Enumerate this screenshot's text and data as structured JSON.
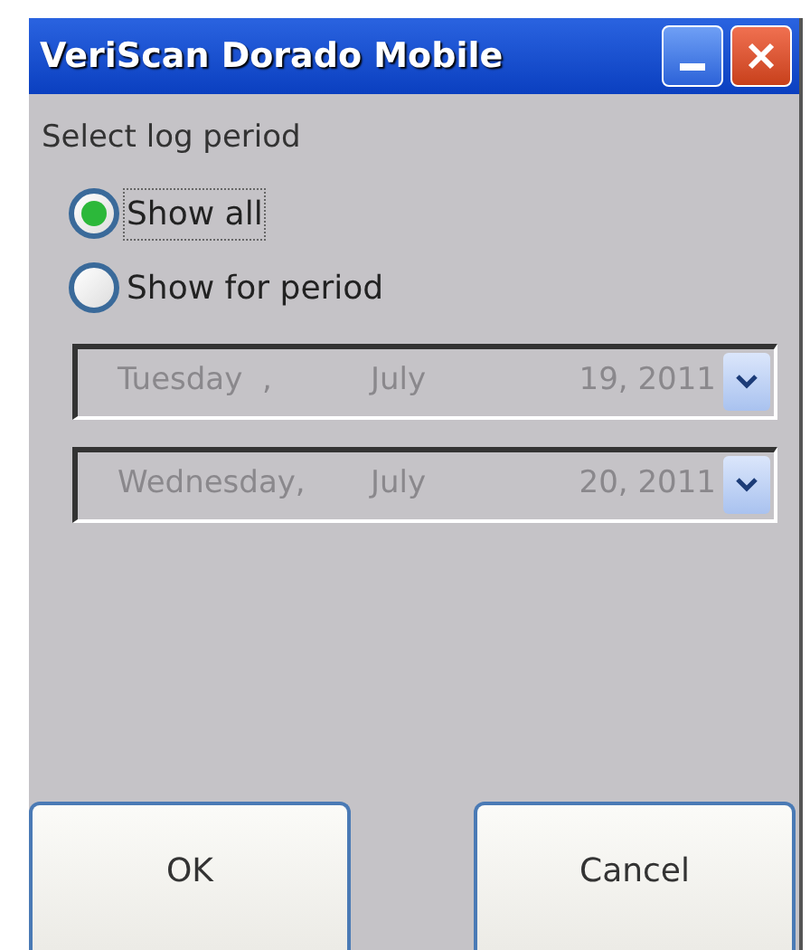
{
  "window": {
    "title": "VeriScan Dorado Mobile"
  },
  "group_label": "Select log period",
  "options": [
    {
      "label": "Show all",
      "selected": true,
      "focused": true
    },
    {
      "label": "Show for period",
      "selected": false,
      "focused": false
    }
  ],
  "date_pickers": [
    {
      "weekday": "Tuesday  ,",
      "month": "July",
      "date": "19, 2011",
      "disabled": true
    },
    {
      "weekday": "Wednesday,",
      "month": "July",
      "date": "20, 2011",
      "disabled": true
    }
  ],
  "buttons": [
    "OK",
    "Cancel"
  ]
}
